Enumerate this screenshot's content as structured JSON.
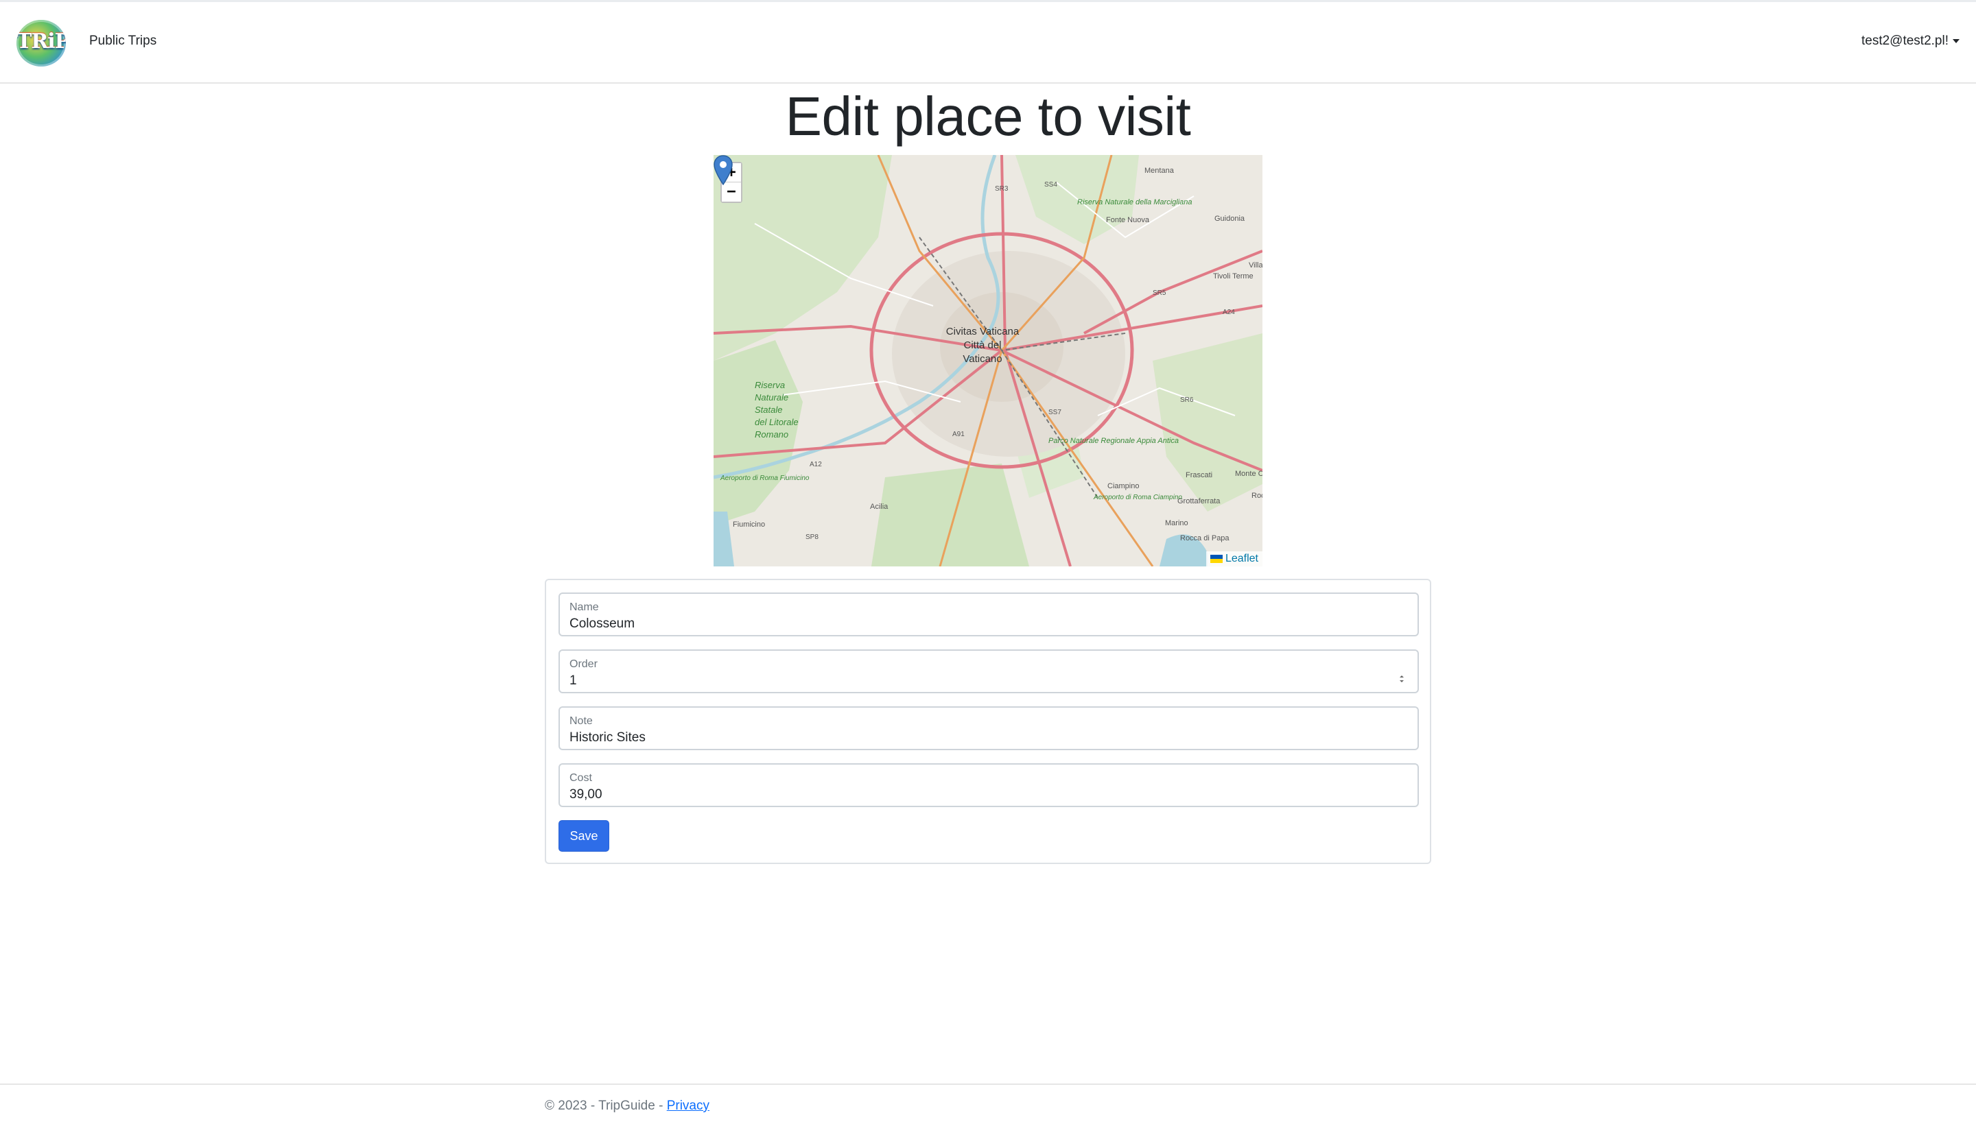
{
  "navbar": {
    "logo_text": "TRiP",
    "nav_link": "Public Trips",
    "user": "test2@test2.pl!"
  },
  "page": {
    "title": "Edit place to visit"
  },
  "map": {
    "zoom_in": "+",
    "zoom_out": "−",
    "attribution": "Leaflet",
    "labels": [
      "Mentana",
      "Fonte Nuova",
      "Guidonia",
      "Tivoli Terme",
      "Villan",
      "Civitas Vaticana",
      "Città del",
      "Vaticano",
      "Riserva",
      "Naturale",
      "Statale",
      "del Litorale",
      "Romano",
      "Frascati",
      "Monte Compa",
      "Grottaferrata",
      "Rocca",
      "Ciampino",
      "Marino",
      "Rocca di Papa",
      "Fiumicino",
      "Acilia",
      "Riserva Naturale della Marcigliana",
      "Parco Naturale Regionale Appia Antica",
      "Aeroporto di Roma Ciampino",
      "Aeroporto di Roma Fiumicino",
      "SR3",
      "SS4",
      "SR5",
      "A24",
      "SR6",
      "SS7",
      "A91",
      "A12",
      "SP8"
    ]
  },
  "form": {
    "name": {
      "label": "Name",
      "value": "Colosseum"
    },
    "order": {
      "label": "Order",
      "value": "1"
    },
    "note": {
      "label": "Note",
      "value": "Historic Sites"
    },
    "cost": {
      "label": "Cost",
      "value": "39,00"
    },
    "save_label": "Save"
  },
  "footer": {
    "text": "© 2023 - TripGuide - ",
    "privacy_link": "Privacy"
  },
  "colors": {
    "primary": "#2e6de8",
    "marker": "#3f7fcd"
  }
}
